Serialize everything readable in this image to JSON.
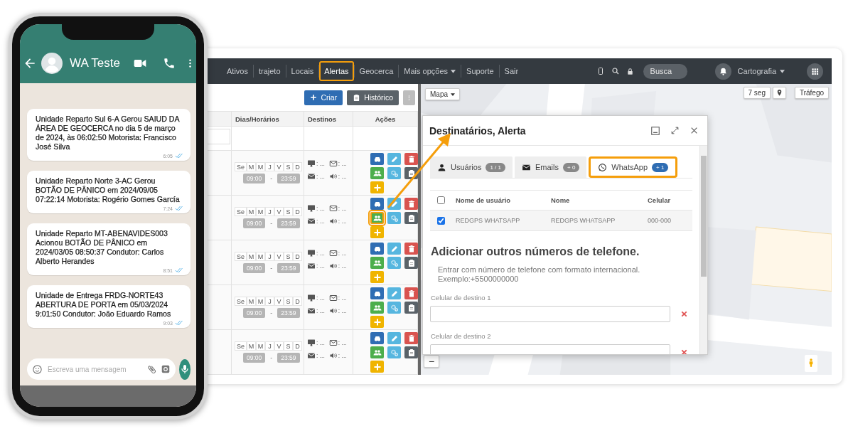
{
  "phone": {
    "contact": "WA Teste",
    "messages": [
      {
        "text": "Unidade Reparto Sul 6-A Gerou SAIUD DA ÁREA DE GEOCERCA no dia 5 de março de 2024, às 06:02:50 Motorista: Francisco José Silva",
        "time": "6:05"
      },
      {
        "text": "Unidade Reparto Norte 3-AC Gerou BOTÃO DE PÂNICO em 2024/09/05 07:22:14 Motorista: Rogério Gomes García",
        "time": "7:24"
      },
      {
        "text": "Unidade Reparto MT-ABENAVIDES003 Acionou BOTÃO DE PÂNICO em 2024/03/05 08:50:37 Condutor: Carlos Alberto Herandes",
        "time": "8:51"
      },
      {
        "text": "Unidade de Entrega FRDG-NORTE43 ABERTURA DE PORTA em 05/03/2024 9:01:50 Condutor: João Eduardo Ramos",
        "time": "9:03"
      }
    ],
    "composer": {
      "placeholder": "Escreva uma mensagem"
    }
  },
  "nav": {
    "items": [
      {
        "label": "Ativos",
        "selected": false,
        "highlighted": false,
        "dropdown": false
      },
      {
        "label": "trajeto",
        "selected": false,
        "highlighted": false,
        "dropdown": false
      },
      {
        "label": "Locais",
        "selected": false,
        "highlighted": false,
        "dropdown": false
      },
      {
        "label": "Alertas",
        "selected": true,
        "highlighted": true,
        "dropdown": false
      },
      {
        "label": "Geocerca",
        "selected": false,
        "highlighted": false,
        "dropdown": false
      },
      {
        "label": "Mais opções",
        "selected": false,
        "highlighted": false,
        "dropdown": true
      },
      {
        "label": "Suporte",
        "selected": false,
        "highlighted": false,
        "dropdown": false
      },
      {
        "label": "Sair",
        "selected": false,
        "highlighted": false,
        "dropdown": false
      }
    ],
    "search": {
      "placeholder": "Busca"
    },
    "user_menu": "Cartografia"
  },
  "alerts_panel": {
    "buttons": [
      "Criar",
      "Histórico"
    ],
    "columns": [
      "Dias/Horários",
      "Destinos",
      "Ações"
    ],
    "actions": [
      {
        "kind": "vehicle"
      },
      {
        "kind": "edit"
      },
      {
        "kind": "delete"
      },
      {
        "kind": "users"
      },
      {
        "kind": "settings"
      },
      {
        "kind": "report"
      },
      {
        "kind": "add"
      }
    ],
    "rows": [
      {
        "days": [
          "Se",
          "M",
          "M",
          "J",
          "V",
          "S",
          "D"
        ],
        "start": "09:00",
        "separator": "-",
        "end": "23:59",
        "destinations": [
          {
            "kind": "screen",
            "text": ": ..."
          },
          {
            "kind": "email",
            "text": ": ..."
          },
          {
            "kind": "message",
            "text": ": ..."
          },
          {
            "kind": "sound",
            "text": ": ..."
          }
        ],
        "highlighted": false
      },
      {
        "days": [
          "Se",
          "M",
          "M",
          "J",
          "V",
          "S",
          "D"
        ],
        "start": "09:00",
        "separator": "-",
        "end": "23:59",
        "destinations": [
          {
            "kind": "screen",
            "text": ": ..."
          },
          {
            "kind": "email",
            "text": ": ..."
          },
          {
            "kind": "message",
            "text": ": ..."
          },
          {
            "kind": "sound",
            "text": ": ..."
          }
        ],
        "highlighted": true
      },
      {
        "days": [
          "Se",
          "M",
          "M",
          "J",
          "V",
          "S",
          "D"
        ],
        "start": "09:00",
        "separator": "-",
        "end": "23:59",
        "destinations": [
          {
            "kind": "screen",
            "text": ": ..."
          },
          {
            "kind": "email",
            "text": ": ..."
          },
          {
            "kind": "message",
            "text": ": ..."
          },
          {
            "kind": "sound",
            "text": ": ..."
          }
        ],
        "highlighted": false
      },
      {
        "days": [
          "Se",
          "M",
          "M",
          "J",
          "V",
          "S",
          "D"
        ],
        "start": "09:00",
        "separator": "-",
        "end": "23:59",
        "destinations": [
          {
            "kind": "screen",
            "text": ": ..."
          },
          {
            "kind": "email",
            "text": ": ..."
          },
          {
            "kind": "message",
            "text": ": ..."
          },
          {
            "kind": "sound",
            "text": ": ..."
          }
        ],
        "highlighted": false
      },
      {
        "days": [
          "Se",
          "M",
          "M",
          "J",
          "V",
          "S",
          "D"
        ],
        "start": "09:00",
        "separator": "-",
        "end": "23:59",
        "destinations": [
          {
            "kind": "screen",
            "text": ": ..."
          },
          {
            "kind": "email",
            "text": ": ..."
          },
          {
            "kind": "message",
            "text": ": ..."
          },
          {
            "kind": "sound",
            "text": ": ..."
          }
        ],
        "highlighted": false
      }
    ]
  },
  "map": {
    "zoom_out_button": "−",
    "type_button": "Mapa",
    "refresh_button": "7 seg",
    "traffic_button": "Tráfego"
  },
  "modal": {
    "title": "Destinatários, Alerta",
    "tabs": [
      {
        "label": "Usuários",
        "count": "1 / 1",
        "selected": false,
        "highlighted": false,
        "kind": "users"
      },
      {
        "label": "Emails",
        "count": "+ 0",
        "selected": false,
        "highlighted": false,
        "kind": "email"
      },
      {
        "label": "WhatsApp",
        "count": "+ 1",
        "selected": true,
        "highlighted": true,
        "kind": "whatsapp"
      }
    ],
    "table": {
      "all_checked": false,
      "columns": [
        "Nome de usuário",
        "Nome",
        "Celular"
      ],
      "rows": [
        {
          "checked": true,
          "cells": [
            "REDGPS WHATSAPP",
            "REDGPS WHATSAPP",
            "000-000"
          ]
        }
      ]
    },
    "heading": "Adicionar outros números de telefone.",
    "hint": "Entrar com número de telefone com formato internacional.",
    "example": "Exemplo:+5500000000",
    "fields": [
      {
        "label": "Celular de destino 1"
      },
      {
        "label": "Celular de destino 2"
      }
    ]
  }
}
